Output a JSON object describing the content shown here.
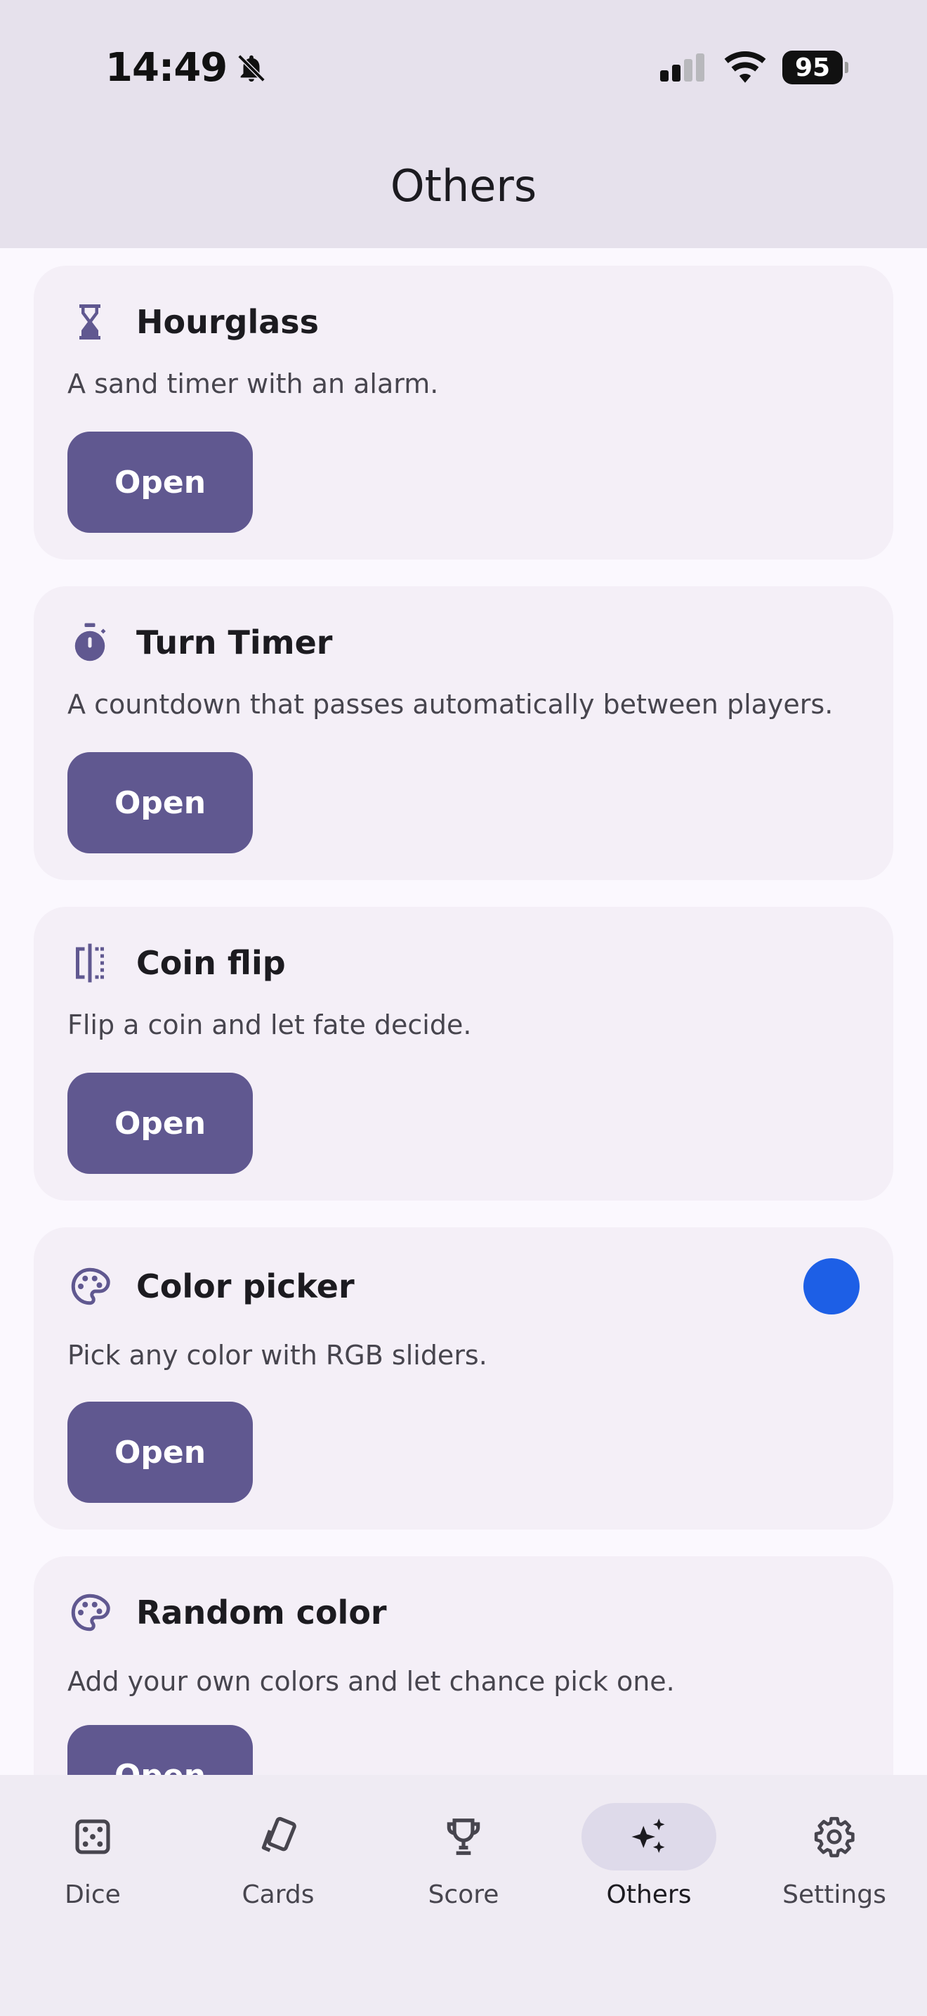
{
  "status_bar": {
    "time": "14:49",
    "battery": "95"
  },
  "header": {
    "title": "Others"
  },
  "cards": [
    {
      "icon": "hourglass-icon",
      "title": "Hourglass",
      "description": "A sand timer with an alarm.",
      "button": "Open"
    },
    {
      "icon": "stopwatch-icon",
      "title": "Turn Timer",
      "description": "A countdown that passes automatically between players.",
      "button": "Open"
    },
    {
      "icon": "coin-flip-icon",
      "title": "Coin flip",
      "description": "Flip a coin and let fate decide.",
      "button": "Open"
    },
    {
      "icon": "palette-icon",
      "title": "Color picker",
      "description": "Pick any color with RGB sliders.",
      "button": "Open",
      "swatch_color": "#1d5fe6"
    },
    {
      "icon": "palette-icon",
      "title": "Random color",
      "description": "Add your own colors and let chance pick one.",
      "button": "Open"
    }
  ],
  "bottom_nav": {
    "active": "Others",
    "items": [
      {
        "label": "Dice",
        "icon": "dice-icon"
      },
      {
        "label": "Cards",
        "icon": "cards-icon"
      },
      {
        "label": "Score",
        "icon": "trophy-icon"
      },
      {
        "label": "Others",
        "icon": "sparkles-icon"
      },
      {
        "label": "Settings",
        "icon": "gear-icon"
      }
    ]
  },
  "colors": {
    "primary": "#605890",
    "surface": "#fbf8fe",
    "card": "#f4eff7",
    "top_bar": "#e6e1ec",
    "nav_bar": "#efebf3",
    "nav_active_pill": "#dedaea"
  }
}
